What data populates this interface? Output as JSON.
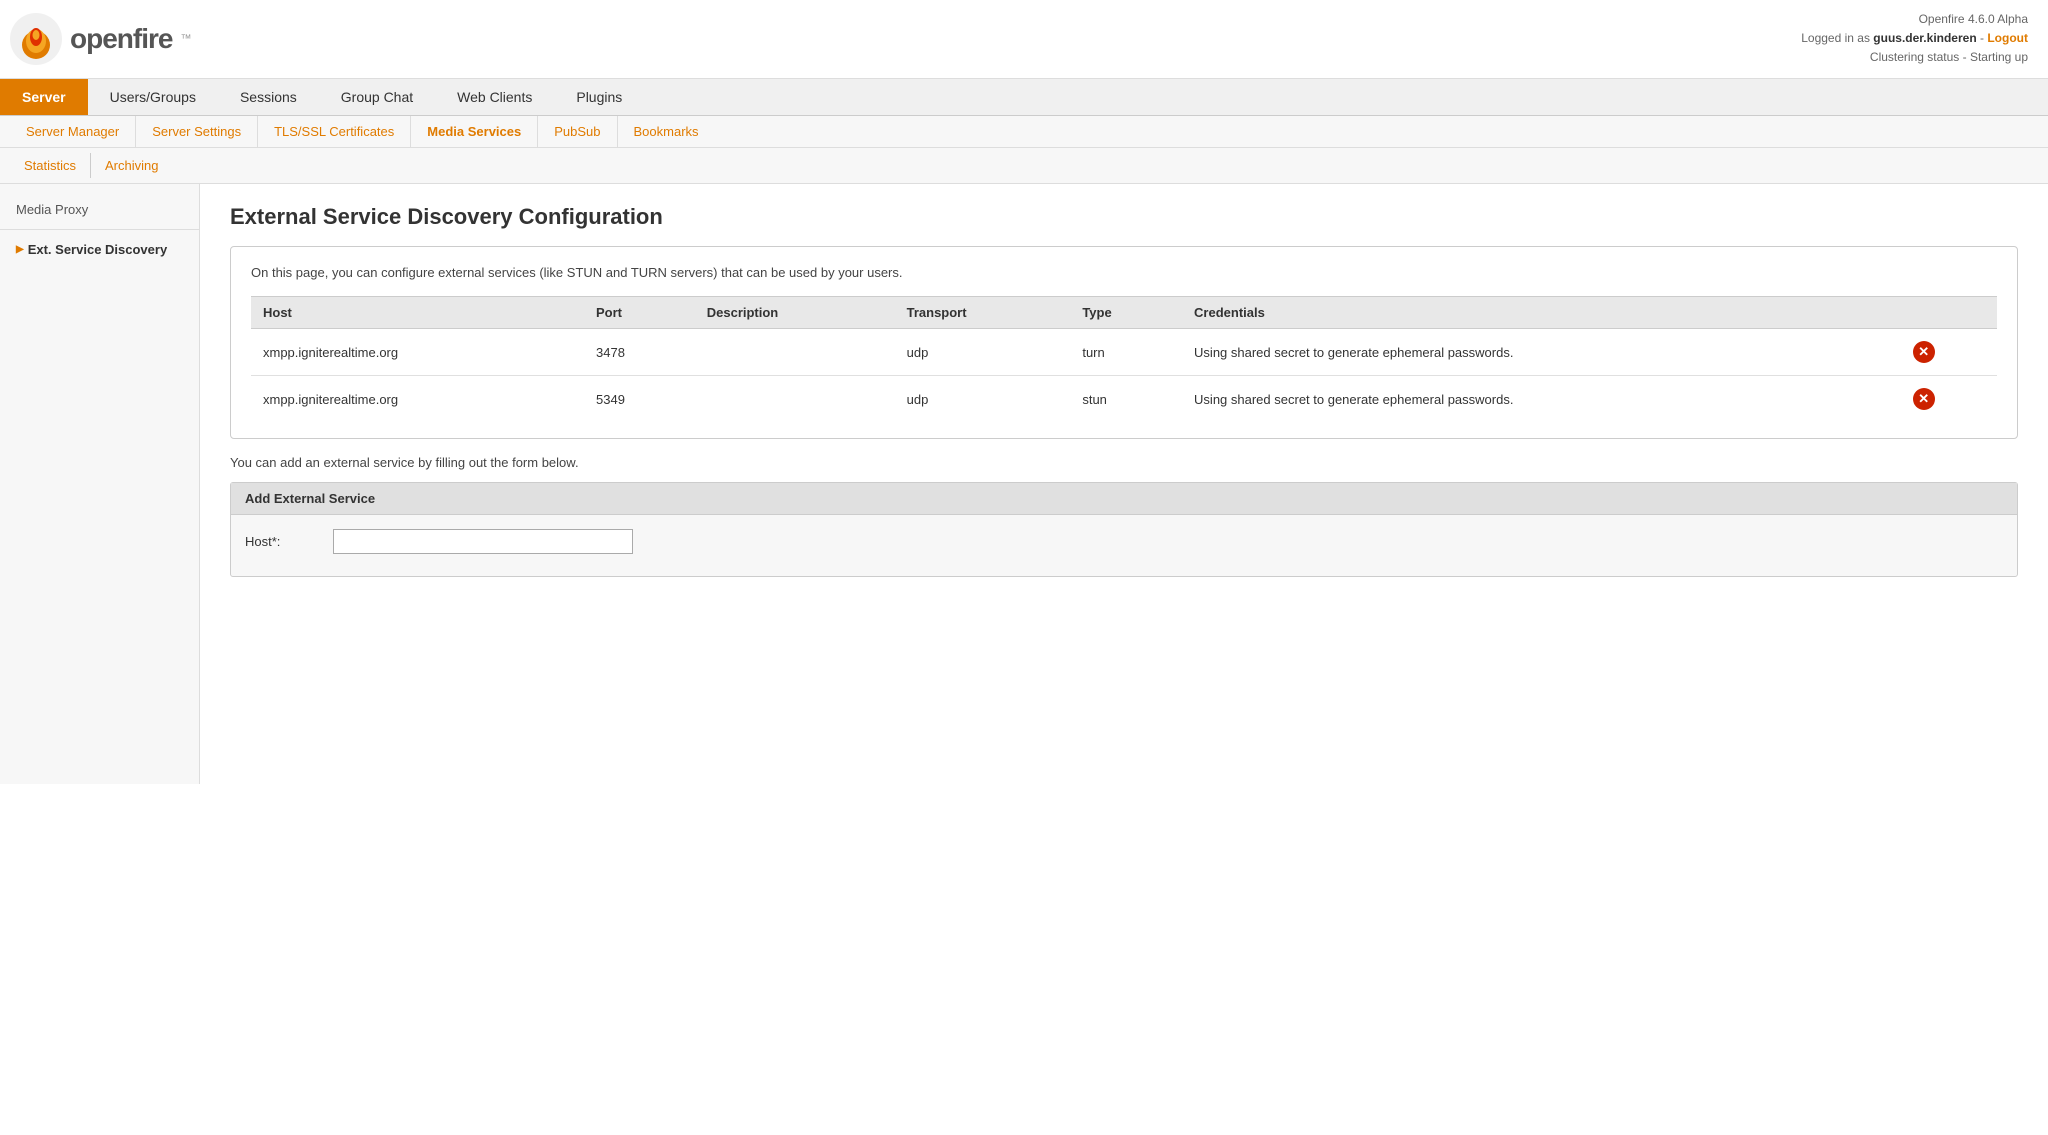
{
  "header": {
    "app_name": "openfire",
    "version_text": "Openfire 4.6.0 Alpha",
    "logged_in_text": "Logged in as",
    "username": "guus.der.kinderen",
    "separator": " - ",
    "logout_label": "Logout",
    "clustering_text": "Clustering status - Starting up"
  },
  "main_nav": {
    "tabs": [
      {
        "label": "Server",
        "active": true
      },
      {
        "label": "Users/Groups",
        "active": false
      },
      {
        "label": "Sessions",
        "active": false
      },
      {
        "label": "Group Chat",
        "active": false
      },
      {
        "label": "Web Clients",
        "active": false
      },
      {
        "label": "Plugins",
        "active": false
      }
    ]
  },
  "sub_nav": {
    "items": [
      {
        "label": "Server Manager",
        "active": false
      },
      {
        "label": "Server Settings",
        "active": false
      },
      {
        "label": "TLS/SSL Certificates",
        "active": false
      },
      {
        "label": "Media Services",
        "active": true
      },
      {
        "label": "PubSub",
        "active": false
      },
      {
        "label": "Bookmarks",
        "active": false
      }
    ]
  },
  "sub_sub_nav": {
    "items": [
      {
        "label": "Statistics",
        "active": false
      },
      {
        "label": "Archiving",
        "active": false
      }
    ]
  },
  "sidebar": {
    "items": [
      {
        "label": "Media Proxy",
        "active": false,
        "arrow": false
      },
      {
        "label": "Ext. Service Discovery",
        "active": true,
        "arrow": true
      }
    ]
  },
  "page": {
    "title": "External Service Discovery Configuration",
    "description": "On this page, you can configure external services (like STUN and TURN servers) that can be used by your users.",
    "table": {
      "headers": [
        "Host",
        "Port",
        "Description",
        "Transport",
        "Type",
        "Credentials"
      ],
      "rows": [
        {
          "host": "xmpp.igniterealtime.org",
          "port": "3478",
          "description": "",
          "transport": "udp",
          "type": "turn",
          "credentials": "Using shared secret to generate ephemeral passwords."
        },
        {
          "host": "xmpp.igniterealtime.org",
          "port": "5349",
          "description": "",
          "transport": "udp",
          "type": "stun",
          "credentials": "Using shared secret to generate ephemeral passwords."
        }
      ]
    },
    "add_text": "You can add an external service by filling out the form below.",
    "add_section_title": "Add External Service",
    "form": {
      "host_label": "Host*:",
      "host_placeholder": ""
    }
  }
}
